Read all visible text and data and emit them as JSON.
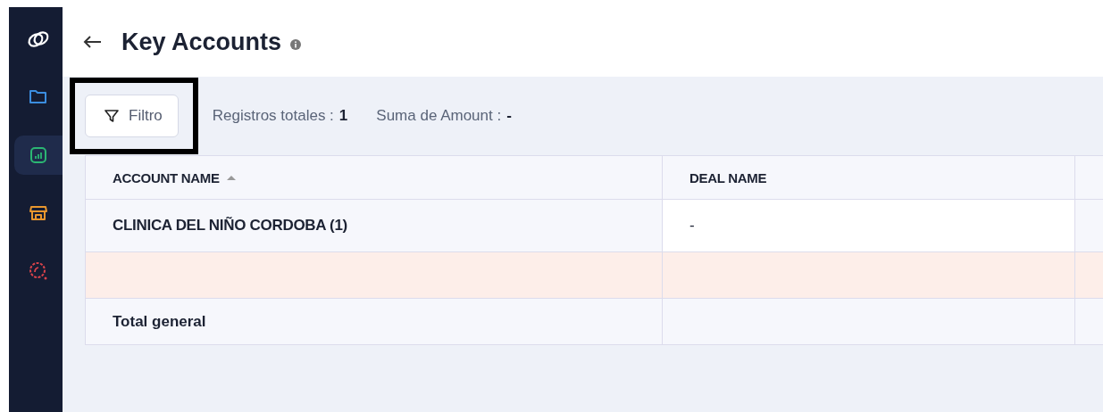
{
  "sidebar": {
    "items": [
      {
        "selected": false
      },
      {
        "selected": false
      },
      {
        "selected": true
      },
      {
        "selected": false
      },
      {
        "selected": false
      }
    ]
  },
  "header": {
    "title": "Key Accounts"
  },
  "toolbar": {
    "filter_button": "Filtro",
    "highlighted": true,
    "stats": [
      {
        "label": "Registros totales :",
        "value": "1"
      },
      {
        "label": "Suma de Amount :",
        "value": "-"
      }
    ]
  },
  "table": {
    "columns": [
      {
        "label": "ACCOUNT NAME",
        "sorted": true
      },
      {
        "label": "DEAL NAME",
        "sorted": false
      }
    ],
    "rows": [
      {
        "kind": "data",
        "cells": [
          "CLINICA DEL NIÑO CORDOBA (1)",
          "-"
        ]
      },
      {
        "kind": "subtotal",
        "cells": []
      },
      {
        "kind": "total",
        "cells": [
          "Total general"
        ]
      }
    ]
  }
}
